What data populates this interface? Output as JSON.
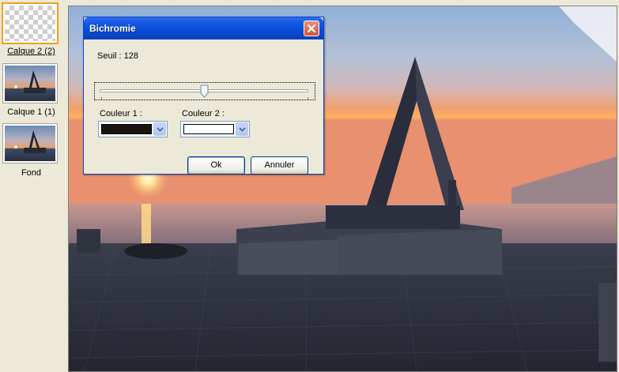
{
  "layers": [
    {
      "name": "Calque 2 (2)",
      "selected": true,
      "thumbnail": "transparent-checker"
    },
    {
      "name": "Calque 1 (1)",
      "selected": false,
      "thumbnail": "sunset-monument"
    },
    {
      "name": "Fond",
      "selected": false,
      "thumbnail": "sunset-monument"
    }
  ],
  "dialog": {
    "title": "Bichromie",
    "threshold_label": "Seuil : 128",
    "threshold_value": 128,
    "threshold_max": 255,
    "color1_label": "Couleur 1 :",
    "color1_value": "#1a1410",
    "color2_label": "Couleur 2 :",
    "color2_value": "#ffffff",
    "ok_label": "Ok",
    "cancel_label": "Annuler"
  },
  "colors": {
    "titlebar": "#0a4fd8",
    "dialog_bg": "#ece9d8",
    "selection_border": "#f0a020"
  },
  "icons": {
    "close": "close-icon",
    "dropdown": "chevron-down-icon"
  }
}
